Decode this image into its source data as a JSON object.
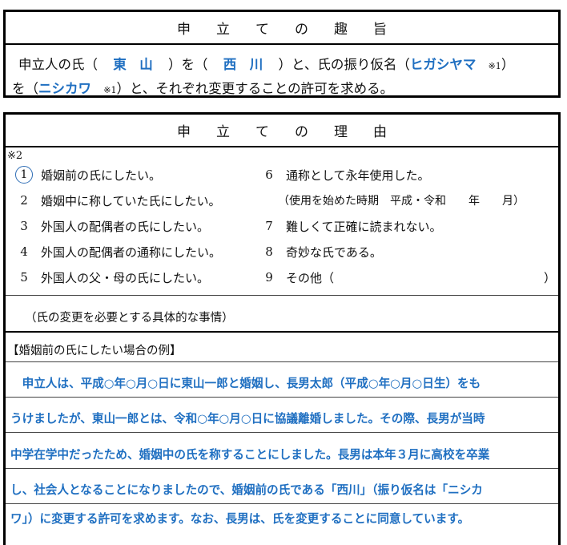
{
  "purpose": {
    "title_chars": [
      "申",
      "立",
      "て",
      "の",
      "趣",
      "旨"
    ],
    "line1_a": "申立人の氏（",
    "old_surname": "東　山",
    "line1_b": "）を（",
    "new_surname": "西　川",
    "line1_c": "）と、氏の振り仮名（",
    "old_kana": "ヒガシヤマ",
    "note_mark_1": "※1",
    "line1_d": "）",
    "line2_a": "を（",
    "new_kana": "ニシカワ",
    "note_mark_2": "※1",
    "line2_b": "）と、それぞれ変更することの許可を求める。"
  },
  "reason": {
    "title_chars": [
      "申",
      "立",
      "て",
      "の",
      "理",
      "由"
    ],
    "note_mark": "※2",
    "items": [
      {
        "num": "1",
        "text": "婚姻前の氏にしたい。",
        "selected": true
      },
      {
        "num": "2",
        "text": "婚姻中に称していた氏にしたい。"
      },
      {
        "num": "3",
        "text": "外国人の配偶者の氏にしたい。"
      },
      {
        "num": "4",
        "text": "外国人の配偶者の通称にしたい。"
      },
      {
        "num": "5",
        "text": "外国人の父・母の氏にしたい。"
      },
      {
        "num": "6",
        "text": "通称として永年使用した。"
      },
      {
        "num": "7",
        "text": "難しくて正確に読まれない。"
      },
      {
        "num": "8",
        "text": "奇妙な氏である。"
      },
      {
        "num": "9",
        "text": "その他（"
      }
    ],
    "usage_note": "（使用を始めた時期　平成・令和　　年　　月）",
    "other_close": "）",
    "specific_label": "（氏の変更を必要とする具体的な事情）",
    "example_title": "【婚姻前の氏にしたい場合の例】",
    "example_lines": [
      "　申立人は、平成○年○月○日に東山一郎と婚姻し、長男太郎（平成○年○月○日生）をも",
      "うけましたが、東山一郎とは、令和○年○月○日に協議離婚しました。その際、長男が当時",
      "中学在学中だったため、婚姻中の氏を称することにしました。長男は本年３月に高校を卒業",
      "し、社会人となることになりましたので、婚姻前の氏である「西川」（振り仮名は「ニシカ",
      "ワ」）に変更する許可を求めます。なお、長男は、氏を変更することに同意しています。"
    ]
  },
  "colors": {
    "accent": "#1f6fc1",
    "circle": "#2e6db5"
  }
}
